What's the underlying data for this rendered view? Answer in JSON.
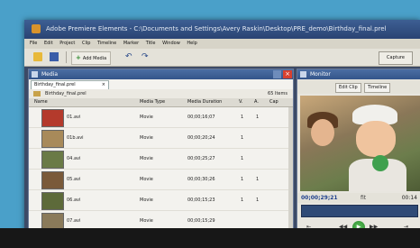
{
  "window": {
    "title": "Adobe Premiere Elements - C:\\Documents and Settings\\Avery Raskin\\Desktop\\PRE_demo\\Birthday_final.prel"
  },
  "menu": [
    "File",
    "Edit",
    "Project",
    "Clip",
    "Timeline",
    "Marker",
    "Title",
    "Window",
    "Help"
  ],
  "toolbar": {
    "add_media_label": "Add Media",
    "capture_label": "Capture"
  },
  "media_panel": {
    "title": "Media",
    "tab_label": "Birthday_final.prel",
    "tab_close": "×",
    "project_name": "Birthday_final.prel",
    "item_count": "65 Items",
    "columns": [
      "Name",
      "Media Type",
      "Media Duration",
      "V.",
      "A.",
      "Cap"
    ],
    "rows": [
      {
        "name": "01.avi",
        "type": "Movie",
        "duration": "00;00;16;07",
        "v": "1",
        "a": "1",
        "color": "#b43a2c"
      },
      {
        "name": "01b.avi",
        "type": "Movie",
        "duration": "00;00;20;24",
        "v": "1",
        "a": "",
        "color": "#a88a5a"
      },
      {
        "name": "04.avi",
        "type": "Movie",
        "duration": "00;00;25;27",
        "v": "1",
        "a": "",
        "color": "#6a7a46"
      },
      {
        "name": "05.avi",
        "type": "Movie",
        "duration": "00;00;30;26",
        "v": "1",
        "a": "1",
        "color": "#7a5a3a"
      },
      {
        "name": "06.avi",
        "type": "Movie",
        "duration": "00;00;15;23",
        "v": "1",
        "a": "1",
        "color": "#5d6a3a"
      },
      {
        "name": "07.avi",
        "type": "Movie",
        "duration": "00;00;15;29",
        "v": "",
        "a": "",
        "color": "#8a7a5a"
      }
    ]
  },
  "monitor_panel": {
    "title": "Monitor",
    "edit_clip_label": "Edit Clip",
    "timeline_label": "Timeline",
    "current_time": "00;00;29;21",
    "mid_label": "fit",
    "end_time": "00:14"
  }
}
